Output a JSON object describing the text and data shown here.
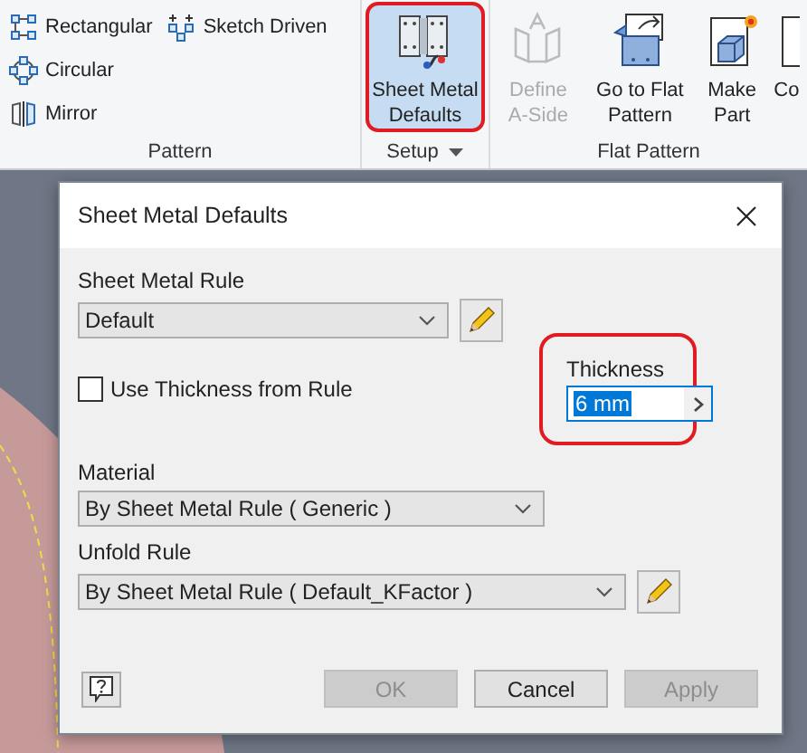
{
  "ribbon": {
    "panels": [
      {
        "kind": "small",
        "label": "Pattern",
        "has_menu": false,
        "items": [
          {
            "label": "Rectangular"
          },
          {
            "label": "Circular"
          },
          {
            "label": "Mirror"
          },
          {
            "label": "Sketch Driven"
          }
        ]
      },
      {
        "kind": "large",
        "label": "Setup",
        "has_menu": true,
        "items": [
          {
            "label": "Sheet Metal Defaults",
            "disabled": false,
            "selected": true,
            "annotated": true
          }
        ]
      },
      {
        "kind": "large",
        "label": "Flat Pattern",
        "has_menu": false,
        "items": [
          {
            "label": "Define A-Side",
            "disabled": true,
            "selected": false,
            "annotated": false
          },
          {
            "label": "Go to Flat Pattern",
            "disabled": false,
            "selected": false,
            "annotated": false
          },
          {
            "label": "Make Part",
            "disabled": false,
            "selected": false,
            "annotated": false
          },
          {
            "label": "Co",
            "disabled": false,
            "selected": false,
            "annotated": false
          }
        ]
      }
    ]
  },
  "dialog": {
    "title": "Sheet Metal Defaults",
    "sheet_metal_rule": {
      "label": "Sheet Metal Rule",
      "value": "Default"
    },
    "use_thickness_from_rule": {
      "label": "Use Thickness from Rule",
      "checked": false
    },
    "thickness": {
      "label": "Thickness",
      "value": "6 mm",
      "text_selected": true,
      "annotated": true
    },
    "material": {
      "label": "Material",
      "value": "By Sheet Metal Rule ( Generic )"
    },
    "unfold_rule": {
      "label": "Unfold Rule",
      "value": "By Sheet Metal Rule ( Default_KFactor )"
    },
    "buttons": [
      {
        "label": "OK",
        "disabled": true
      },
      {
        "label": "Cancel",
        "disabled": false
      },
      {
        "label": "Apply",
        "disabled": true
      }
    ]
  }
}
